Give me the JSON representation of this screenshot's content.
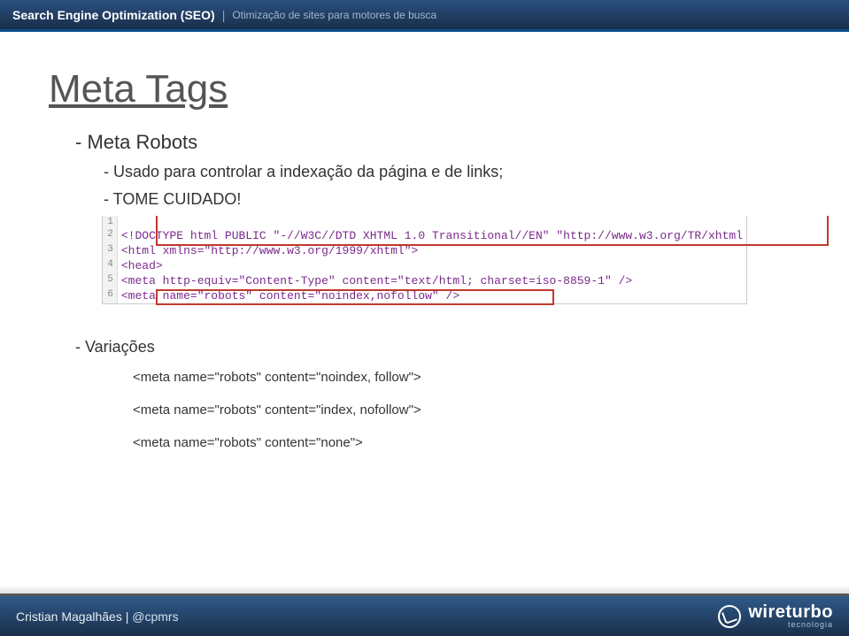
{
  "header": {
    "title_main": "Search Engine Optimization (SEO)",
    "separator": "|",
    "title_sub": "Otimização de sites para motores de busca"
  },
  "slide": {
    "title": "Meta Tags",
    "bullet1": "- Meta Robots",
    "bullet2a": "- Usado para controlar a indexação da página e de links;",
    "bullet2b": "- TOME CUIDADO!",
    "code": {
      "lines": [
        "",
        "<!DOCTYPE html PUBLIC \"-//W3C//DTD XHTML 1.0 Transitional//EN\" \"http://www.w3.org/TR/xhtml",
        "<html xmlns=\"http://www.w3.org/1999/xhtml\">",
        "<head>",
        "<meta http-equiv=\"Content-Type\" content=\"text/html; charset=iso-8859-1\" />",
        "<meta name=\"robots\" content=\"noindex,nofollow\" />"
      ],
      "nums": [
        "1",
        "2",
        "3",
        "4",
        "5",
        "6"
      ]
    },
    "variacoes_label": "- Variações",
    "variations": [
      "<meta name=\"robots\" content=\"noindex, follow\">",
      "<meta name=\"robots\" content=\"index, nofollow\">",
      "<meta name=\"robots\" content=\"none\">"
    ]
  },
  "footer": {
    "author": "Cristian Magalhães",
    "sep": " | ",
    "handle": "@cpmrs",
    "brand_main": "wireturbo",
    "brand_sub": "tecnologia"
  }
}
